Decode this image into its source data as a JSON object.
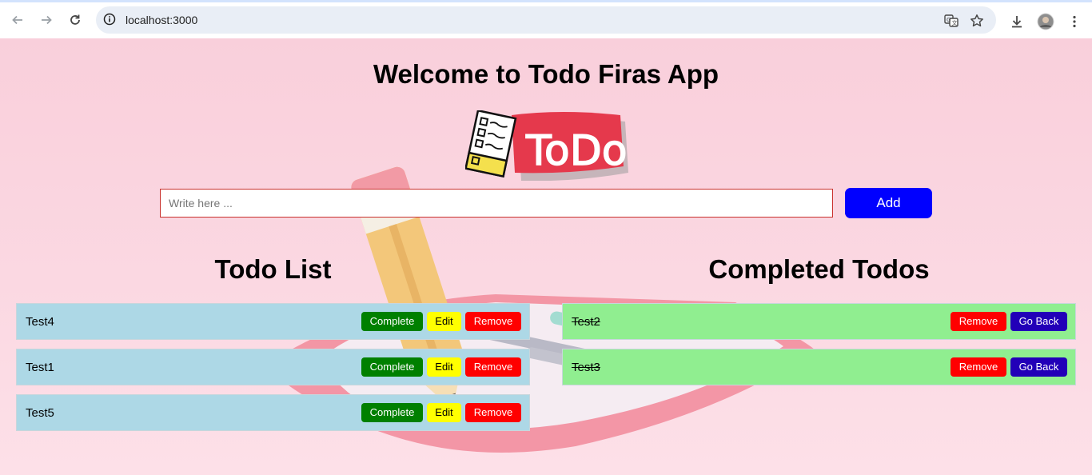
{
  "browser": {
    "url": "localhost:3000",
    "icons": [
      "back-icon",
      "forward-icon",
      "reload-icon",
      "site-info-icon",
      "translate-icon",
      "bookmark-star-icon",
      "download-icon",
      "profile-avatar",
      "menu-dots-icon"
    ]
  },
  "page": {
    "title": "Welcome to Todo Firas App",
    "logo_text": "ToDo",
    "input": {
      "placeholder": "Write here ...",
      "value": ""
    },
    "add_label": "Add",
    "todo_section_title": "Todo List",
    "completed_section_title": "Completed Todos",
    "todos": [
      {
        "text": "Test4"
      },
      {
        "text": "Test1"
      },
      {
        "text": "Test5"
      }
    ],
    "completed": [
      {
        "text": "Test2"
      },
      {
        "text": "Test3"
      }
    ],
    "labels": {
      "complete": "Complete",
      "edit": "Edit",
      "remove": "Remove",
      "go_back": "Go Back"
    }
  },
  "colors": {
    "page_bg": "#fbd3de",
    "add_button": "#0000ff",
    "pending_item": "#add8e6",
    "completed_item": "#90ee90",
    "complete_button": "#008000",
    "edit_button": "#ffff00",
    "remove_button": "#ff0000",
    "go_back_button": "#2200b8"
  }
}
